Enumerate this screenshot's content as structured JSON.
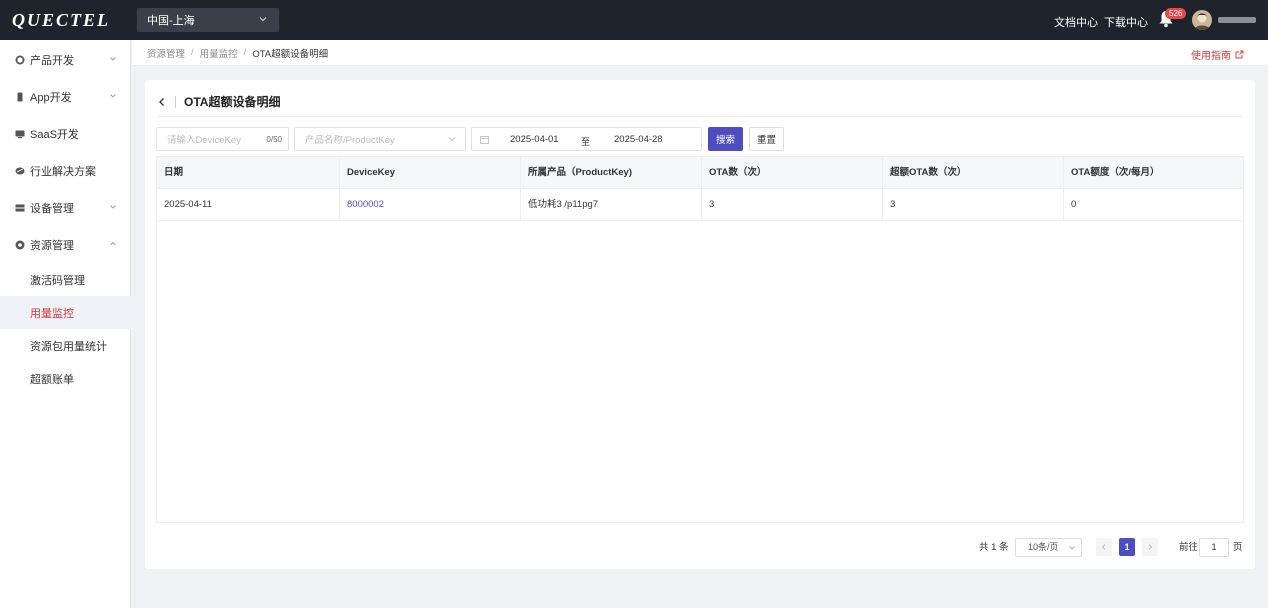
{
  "header": {
    "logo": "QUECTEL",
    "region": "中国-上海",
    "links": [
      "文档中心",
      "下载中心"
    ],
    "notification_count": "526"
  },
  "sidebar": {
    "items": [
      {
        "label": "产品开发",
        "icon": "cube-icon",
        "expandable": true
      },
      {
        "label": "App开发",
        "icon": "phone-icon",
        "expandable": true
      },
      {
        "label": "SaaS开发",
        "icon": "monitor-icon",
        "expandable": false
      },
      {
        "label": "行业解决方案",
        "icon": "layers-icon",
        "expandable": false
      },
      {
        "label": "设备管理",
        "icon": "server-icon",
        "expandable": true
      },
      {
        "label": "资源管理",
        "icon": "gear-icon",
        "expandable": true
      }
    ],
    "sub_items": [
      {
        "label": "激活码管理",
        "active": false
      },
      {
        "label": "用量监控",
        "active": true
      },
      {
        "label": "资源包用量统计",
        "active": false
      },
      {
        "label": "超额账单",
        "active": false
      }
    ]
  },
  "breadcrumb": {
    "items": [
      "资源管理",
      "用量监控",
      "OTA超额设备明细"
    ],
    "guide": "使用指南"
  },
  "page": {
    "title": "OTA超额设备明细"
  },
  "filters": {
    "devicekey_placeholder": "请输入DeviceKey",
    "devicekey_count": "0/50",
    "product_placeholder": "产品名称/ProductKey",
    "date_start": "2025-04-01",
    "date_sep": "至",
    "date_end": "2025-04-28",
    "search_label": "搜索",
    "reset_label": "重置"
  },
  "table": {
    "columns": [
      "日期",
      "DeviceKey",
      "所属产品（ProductKey)",
      "OTA数（次）",
      "超额OTA数（次）",
      "OTA额度（次/每月）"
    ],
    "rows": [
      [
        "2025-04-11",
        "8000002",
        "低功耗3 /p11pg7",
        "3",
        "3",
        "0"
      ]
    ]
  },
  "pagination": {
    "total": "共 1 条",
    "page_size": "10条/页",
    "current_page": "1",
    "goto_label": "前往",
    "goto_value": "1",
    "page_unit": "页"
  },
  "colors": {
    "primary": "#4f4ec1",
    "accent_red": "#d03b3b",
    "topbar": "#1f232b"
  }
}
